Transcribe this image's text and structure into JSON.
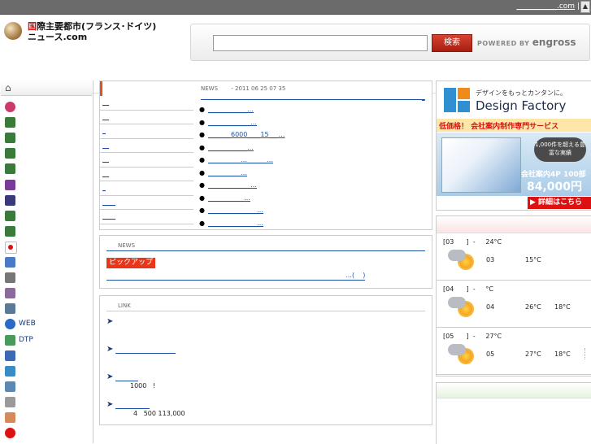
{
  "topbar": {
    "link": "___________.com",
    "sep": "|",
    "scroll": "▲"
  },
  "header": {
    "logo_red": "国",
    "logo_line1": "際主要都市(フランス･ドイツ)",
    "logo_line2": "ニュース.com",
    "search_value": "",
    "search_button": "検索",
    "powered_prefix": "POWERED BY",
    "powered_brand": "engross"
  },
  "sidebar": {
    "home_icon": "home-icon",
    "items": [
      {
        "icon": "globe-icon",
        "label": "",
        "color": "#cc3a6a"
      },
      {
        "icon": "landscape-icon",
        "label": "",
        "color": "#3a7a3a"
      },
      {
        "icon": "landscape-icon",
        "label": "",
        "color": "#3a7a3a"
      },
      {
        "icon": "landscape-icon",
        "label": "",
        "color": "#3a7a3a"
      },
      {
        "icon": "landscape-icon",
        "label": "",
        "color": "#3a7a3a"
      },
      {
        "icon": "landscape-icon",
        "label": "",
        "color": "#7a3a9a"
      },
      {
        "icon": "landscape-icon",
        "label": "",
        "color": "#3a3a7a"
      },
      {
        "icon": "landscape-icon",
        "label": "",
        "color": "#3a7a3a"
      },
      {
        "icon": "landscape-icon",
        "label": "",
        "color": "#3a7a3a"
      },
      {
        "icon": "japan-flag-icon",
        "label": "",
        "color": "#d11"
      },
      {
        "icon": "app-icon",
        "label": "",
        "color": "#4a7ac4"
      },
      {
        "icon": "gear-icon",
        "label": "",
        "color": "#777"
      },
      {
        "icon": "gear-icon",
        "label": "",
        "color": "#8a6a9a"
      },
      {
        "icon": "gear-icon",
        "label": "",
        "color": "#5a7a9a"
      },
      {
        "icon": "globe-icon",
        "label": "WEB",
        "color": "#2a6ac4"
      },
      {
        "icon": "dtp-icon",
        "label": "DTP",
        "color": "#4a9a5a"
      },
      {
        "icon": "magnifier-icon",
        "label": "",
        "color": "#3a6ab4"
      },
      {
        "icon": "pencil-icon",
        "label": "",
        "color": "#3a8ac4"
      },
      {
        "icon": "document-icon",
        "label": "",
        "color": "#5a8ab4"
      },
      {
        "icon": "screen-icon",
        "label": "",
        "color": "#9a9a9a"
      },
      {
        "icon": "person-icon",
        "label": "",
        "color": "#d48a5a"
      },
      {
        "icon": "help-icon",
        "label": "",
        "color": "#d11"
      }
    ]
  },
  "news_main": {
    "heading": "NEWS　　 - 2011 06 25  07 35",
    "tick": "_",
    "categories": [
      "__",
      "__",
      "_",
      "__",
      "__",
      "__",
      "_",
      "____",
      "____"
    ],
    "items": [
      {
        "bullet": "●",
        "text": "____________…"
      },
      {
        "bullet": "●",
        "text": "_____________…"
      },
      {
        "bullet": "●",
        "text": "_______6000____15___…"
      },
      {
        "bullet": "●",
        "text": "____________…"
      },
      {
        "bullet": "●",
        "text": "__________…______…"
      },
      {
        "bullet": "●",
        "text": "__________…"
      },
      {
        "bullet": "●",
        "text": "_____________…"
      },
      {
        "bullet": "●",
        "text": "___________…"
      },
      {
        "bullet": "●",
        "text": "_______________…"
      },
      {
        "bullet": "●",
        "text": "_______________…"
      }
    ]
  },
  "pickup": {
    "title": "NEWS",
    "tick": "_",
    "badge": "ピックアップ",
    "tail": "…(    )"
  },
  "links": {
    "title": "LINK",
    "items": [
      {
        "arrow": "➤",
        "text": "",
        "desc": ""
      },
      {
        "arrow": "➤",
        "text": "______________",
        "desc": ""
      },
      {
        "arrow": "➤",
        "text": "_____",
        "desc": "1000   !"
      },
      {
        "arrow": "➤",
        "text": "________",
        "desc": "4   500 113,000"
      }
    ]
  },
  "ad": {
    "tagline": "デザインをもっとカンタンに。",
    "brand": "Design Factory",
    "band": "低価格！ 会社案内制作専門サービス",
    "badge": "1,000件を超える豊富な実績",
    "price_line": "会社案内4P 100部",
    "price": "84,000円",
    "cta": "▶ 詳細はこちら",
    "colors": {
      "blue": "#2f8fd1",
      "orange": "#f08a1b",
      "red": "#dd1111"
    }
  },
  "weather": {
    "blocks": [
      {
        "line1": "[03      ]  -     24°C",
        "icon": "cloudy-sun-icon",
        "day": "03",
        "hi": "15°C",
        "lo": ""
      },
      {
        "line1": "[04      ]  -     °C",
        "icon": "cloudy-sun-icon",
        "day": "04",
        "hi": "26°C",
        "lo": "18°C"
      },
      {
        "line1": "[05      ]  -     27°C",
        "icon": "cloudy-sun-icon",
        "day": "05",
        "hi": "27°C",
        "lo": "18°C"
      }
    ]
  }
}
